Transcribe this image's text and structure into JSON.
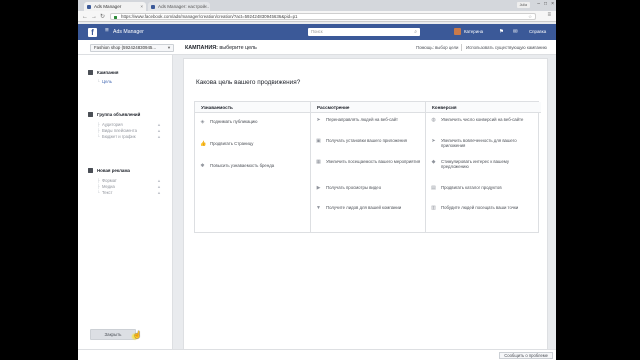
{
  "browser": {
    "tabs": [
      {
        "label": "Ads Manager",
        "active": true
      },
      {
        "label": "Ads Manager: настрой...",
        "active": false
      }
    ],
    "user_chip": "Julia",
    "url": "https://www.facebook.com/ads/manager/creation/creation/?act=592424830945636&pid=p1"
  },
  "fbbar": {
    "logo": "f",
    "title": "Ads Manager",
    "search_placeholder": "Поиск",
    "account_name": "Катерина",
    "help": "Справка"
  },
  "subheader": {
    "account_select": "Fashion shop (592424830945...",
    "campaign_prefix": "КАМПАНИЯ:",
    "campaign_text": "выберите цель",
    "help_link": "Помощь: выбор цели",
    "existing_link": "Использовать существующую кампанию"
  },
  "sidebar": {
    "campaign": {
      "title": "Кампания",
      "items": [
        "Цель"
      ]
    },
    "adset": {
      "title": "Группа объявлений",
      "items": [
        "Аудитория",
        "Виды плейсмента",
        "Бюджет и график"
      ]
    },
    "ad": {
      "title": "Новая реклама",
      "items": [
        "Формат",
        "Медиа",
        "Текст"
      ]
    },
    "continue_label": "Закрыть"
  },
  "main": {
    "question": "Какова цель вашего продвижения?",
    "columns": [
      {
        "header": "Узнаваемость",
        "options": [
          {
            "icon": "megaphone-icon",
            "text": "Поднимать публикацию"
          },
          {
            "icon": "thumbs-up-icon",
            "text": "Продвигать Страницу"
          },
          {
            "icon": "pin-icon",
            "text": "Повысить узнаваемость бренда"
          }
        ]
      },
      {
        "header": "Рассмотрение",
        "options": [
          {
            "icon": "cursor-icon",
            "text": "Перенаправлять людей на веб-сайт"
          },
          {
            "icon": "box-icon",
            "text": "Получать установки вашего приложения"
          },
          {
            "icon": "calendar-icon",
            "text": "Увеличить посещаемость вашего мероприятия"
          },
          {
            "icon": "video-icon",
            "text": "Получать просмотры видео"
          },
          {
            "icon": "funnel-icon",
            "text": "Получите лидов для вашей компании"
          }
        ]
      },
      {
        "header": "Конверсия",
        "options": [
          {
            "icon": "globe-icon",
            "text": "Увеличить число конверсий на веб-сайте"
          },
          {
            "icon": "cursor-icon",
            "text": "Увеличить вовлеченность для вашего приложения"
          },
          {
            "icon": "tag-icon",
            "text": "Стимулировать интерес к вашему предложению"
          },
          {
            "icon": "cart-icon",
            "text": "Продвигать каталог продуктов"
          },
          {
            "icon": "store-icon",
            "text": "Побудите людей посещать ваши точки"
          }
        ]
      }
    ]
  },
  "footer": {
    "report_label": "Сообщить о проблеме"
  }
}
